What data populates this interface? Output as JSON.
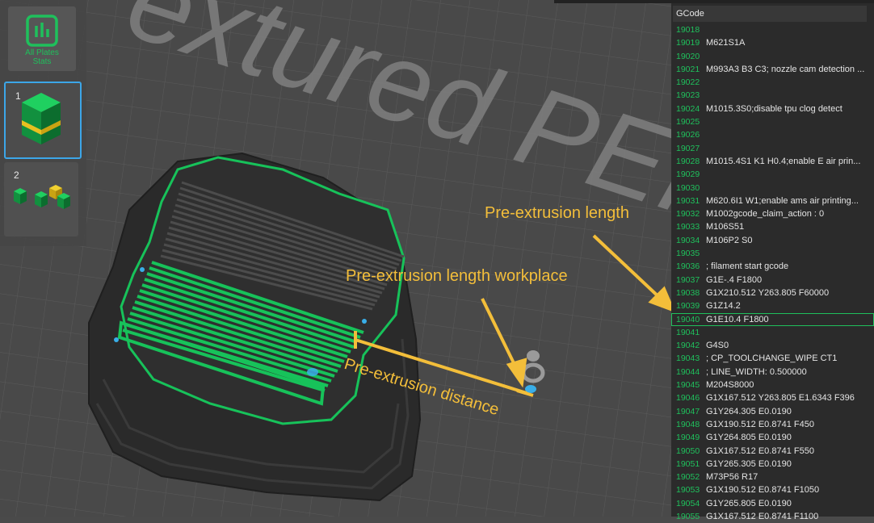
{
  "plates": {
    "stats_label_line1": "All Plates",
    "stats_label_line2": "Stats",
    "items": [
      {
        "number": "1"
      },
      {
        "number": "2"
      }
    ]
  },
  "bed_text": "extured PEI Pla",
  "gcode": {
    "title": "GCode",
    "lines": [
      {
        "n": "19018",
        "code": ""
      },
      {
        "n": "19019",
        "code": "M621S1A"
      },
      {
        "n": "19020",
        "code": ""
      },
      {
        "n": "19021",
        "code": "M993A3 B3 C3; nozzle cam detection ..."
      },
      {
        "n": "19022",
        "code": ""
      },
      {
        "n": "19023",
        "code": ""
      },
      {
        "n": "19024",
        "code": "M1015.3S0;disable tpu clog detect"
      },
      {
        "n": "19025",
        "code": ""
      },
      {
        "n": "19026",
        "code": ""
      },
      {
        "n": "19027",
        "code": ""
      },
      {
        "n": "19028",
        "code": "M1015.4S1 K1 H0.4;enable E air prin..."
      },
      {
        "n": "19029",
        "code": ""
      },
      {
        "n": "19030",
        "code": ""
      },
      {
        "n": "19031",
        "code": "M620.6I1 W1;enable ams air printing..."
      },
      {
        "n": "19032",
        "code": "M1002gcode_claim_action : 0"
      },
      {
        "n": "19033",
        "code": "M106S51"
      },
      {
        "n": "19034",
        "code": "M106P2 S0"
      },
      {
        "n": "19035",
        "code": ""
      },
      {
        "n": "19036",
        "code": "; filament start gcode"
      },
      {
        "n": "19037",
        "code": "G1E-.4 F1800"
      },
      {
        "n": "19038",
        "code": "G1X210.512 Y263.805 F60000"
      },
      {
        "n": "19039",
        "code": "G1Z14.2"
      },
      {
        "n": "19040",
        "code": "G1E10.4 F1800"
      },
      {
        "n": "19041",
        "code": ""
      },
      {
        "n": "19042",
        "code": "G4S0"
      },
      {
        "n": "19043",
        "code": "; CP_TOOLCHANGE_WIPE CT1"
      },
      {
        "n": "19044",
        "code": "; LINE_WIDTH: 0.500000"
      },
      {
        "n": "19045",
        "code": "M204S8000"
      },
      {
        "n": "19046",
        "code": "G1X167.512 Y263.805 E1.6343 F396"
      },
      {
        "n": "19047",
        "code": "G1Y264.305 E0.0190"
      },
      {
        "n": "19048",
        "code": "G1X190.512 E0.8741 F450"
      },
      {
        "n": "19049",
        "code": "G1Y264.805 E0.0190"
      },
      {
        "n": "19050",
        "code": "G1X167.512 E0.8741 F550"
      },
      {
        "n": "19051",
        "code": "G1Y265.305 E0.0190"
      },
      {
        "n": "19052",
        "code": "M73P56 R17"
      },
      {
        "n": "19053",
        "code": "G1X190.512 E0.8741 F1050"
      },
      {
        "n": "19054",
        "code": "G1Y265.805 E0.0190"
      },
      {
        "n": "19055",
        "code": "G1X167.512 E0.8741 F1100"
      }
    ],
    "highlighted_line": "19040"
  },
  "annotations": {
    "pre_extrusion_length": "Pre-extrusion length",
    "pre_extrusion_workplace": "Pre-extrusion length workplace",
    "pre_extrusion_distance": "Pre-extrusion distance"
  },
  "colors": {
    "accent_green": "#1fc05c",
    "annotation": "#f3be3a",
    "selection_blue": "#3ca6e8"
  }
}
